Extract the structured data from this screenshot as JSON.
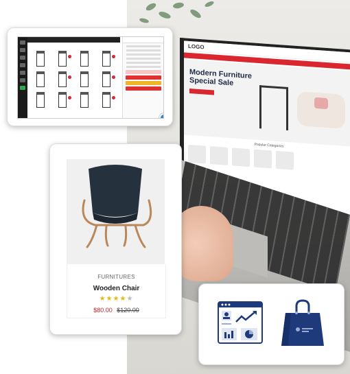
{
  "product_card": {
    "category": "FURNITURES",
    "name": "Wooden Chair",
    "rating": 4,
    "rating_max": 5,
    "price": "$80.00",
    "old_price": "$120.00",
    "stars": [
      "★",
      "★",
      "★",
      "★",
      "★"
    ]
  },
  "laptop_site": {
    "logo": "LOGO",
    "hero_title": "Modern Furniture Special Sale",
    "section_title": "Popular Categories"
  },
  "colors": {
    "accent_red": "#d9262f",
    "navy": "#1f3a7a",
    "star": "#e8b90c",
    "price_red": "#c0262e"
  },
  "icons": {
    "dashboard": "analytics-dashboard-icon",
    "shopping_bag": "shopping-bag-icon"
  }
}
